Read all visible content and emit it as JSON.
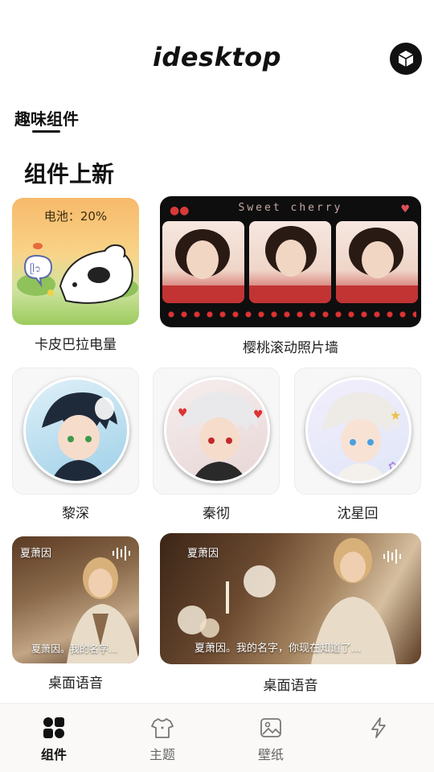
{
  "header": {
    "app_title": "idesktop",
    "icon": "cube-icon"
  },
  "tabs": [
    {
      "label": "趣味组件",
      "active": true
    }
  ],
  "section": {
    "title": "组件上新"
  },
  "widgets": [
    {
      "label": "卡皮巴拉电量",
      "battery_text": "电池：20%",
      "accent": "#f8d489"
    },
    {
      "label": "樱桃滚动照片墙",
      "banner_text": "Sweet cherry",
      "accent": "#c63a3a"
    },
    {
      "label": "黎深"
    },
    {
      "label": "秦彻"
    },
    {
      "label": "沈星回"
    },
    {
      "label": "桌面语音",
      "name": "夏萧因",
      "caption": "夏萧因。我的名字..."
    },
    {
      "label": "桌面语音",
      "name": "夏萧因",
      "caption": "夏萧因。我的名字，你现在知道了..."
    }
  ],
  "bottom_nav": [
    {
      "label": "组件",
      "icon": "widgets-icon",
      "active": true
    },
    {
      "label": "主题",
      "icon": "tshirt-icon",
      "active": false
    },
    {
      "label": "壁纸",
      "icon": "picture-icon",
      "active": false
    },
    {
      "label": "",
      "icon": "lightning-icon",
      "active": false
    }
  ]
}
